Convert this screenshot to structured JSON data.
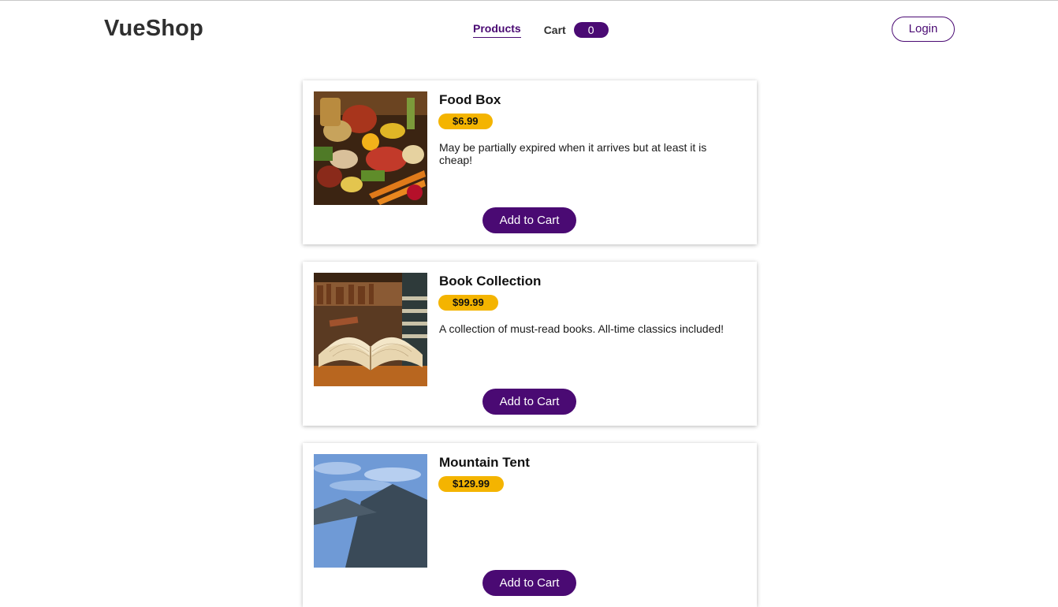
{
  "header": {
    "brand": "VueShop",
    "nav_products": "Products",
    "nav_cart": "Cart",
    "cart_count": "0",
    "login_label": "Login"
  },
  "products": [
    {
      "title": "Food Box",
      "price": "$6.99",
      "description": "May be partially expired when it arrives but at least it is cheap!",
      "button": "Add to Cart",
      "image": "food-box-image"
    },
    {
      "title": "Book Collection",
      "price": "$99.99",
      "description": "A collection of must-read books. All-time classics included!",
      "button": "Add to Cart",
      "image": "book-collection-image"
    },
    {
      "title": "Mountain Tent",
      "price": "$129.99",
      "description": "",
      "button": "Add to Cart",
      "image": "mountain-tent-image"
    }
  ],
  "colors": {
    "accent": "#4a0a73",
    "price_badge": "#f4b400"
  }
}
